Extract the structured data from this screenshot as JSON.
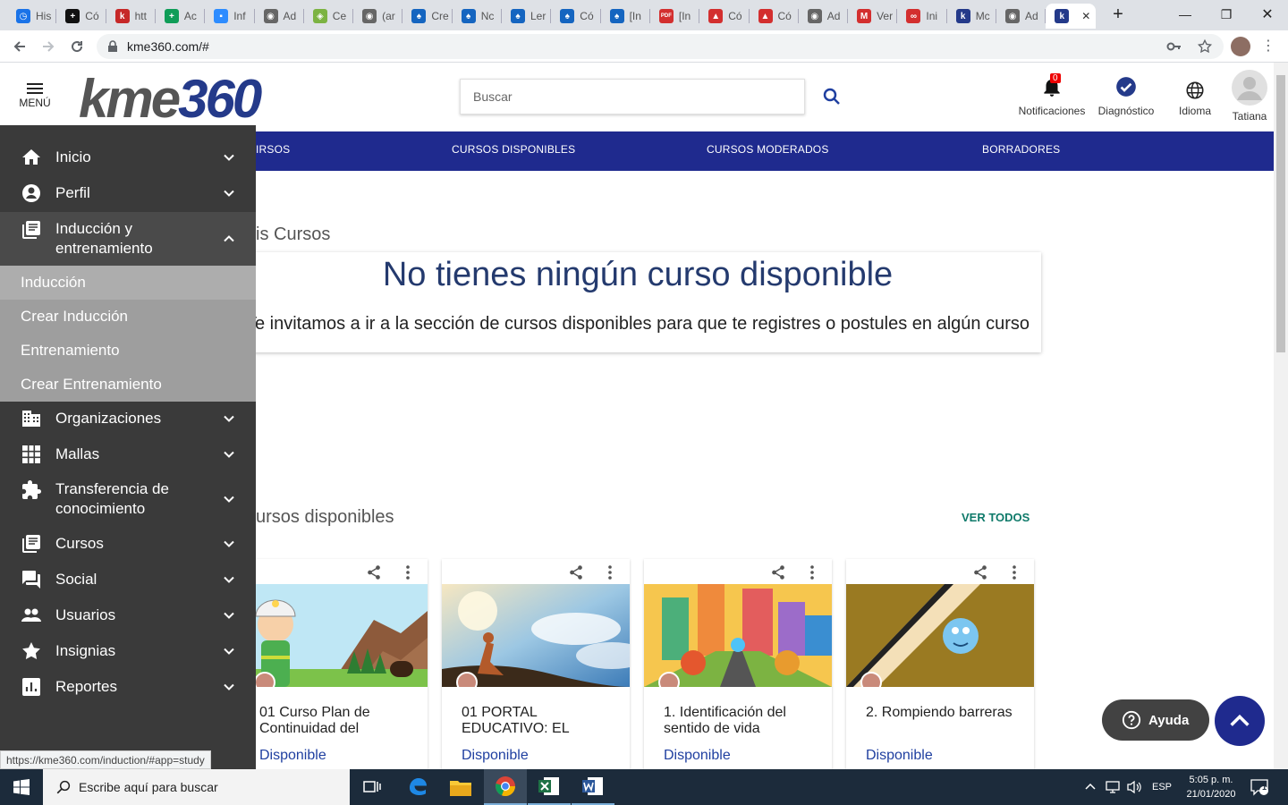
{
  "browser": {
    "tabs": [
      {
        "label": "His",
        "color": "#1a73e8",
        "glyph": "◷"
      },
      {
        "label": "Có",
        "color": "#111111",
        "glyph": "+"
      },
      {
        "label": "htt",
        "color": "#c62828",
        "glyph": "k"
      },
      {
        "label": "Ac",
        "color": "#0f9d58",
        "glyph": "+"
      },
      {
        "label": "Inf",
        "color": "#2d8cff",
        "glyph": "▪"
      },
      {
        "label": "Ad",
        "color": "#666666",
        "glyph": "◉"
      },
      {
        "label": "Ce",
        "color": "#7cb342",
        "glyph": "◈"
      },
      {
        "label": "(ar",
        "color": "#666666",
        "glyph": "◉"
      },
      {
        "label": "Cre",
        "color": "#1565c0",
        "glyph": "♠"
      },
      {
        "label": "Nc",
        "color": "#1565c0",
        "glyph": "♠"
      },
      {
        "label": "Ler",
        "color": "#1565c0",
        "glyph": "♠"
      },
      {
        "label": "Có",
        "color": "#1565c0",
        "glyph": "♠"
      },
      {
        "label": "[In",
        "color": "#1565c0",
        "glyph": "♠"
      },
      {
        "label": "[In",
        "color": "#d32f2f",
        "glyph": "PDF"
      },
      {
        "label": "Có",
        "color": "#d32f2f",
        "glyph": "▲"
      },
      {
        "label": "Có",
        "color": "#d32f2f",
        "glyph": "▲"
      },
      {
        "label": "Ad",
        "color": "#666666",
        "glyph": "◉"
      },
      {
        "label": "Ver",
        "color": "#d32f2f",
        "glyph": "M"
      },
      {
        "label": "Ini",
        "color": "#d32f2f",
        "glyph": "∞"
      },
      {
        "label": "Mc",
        "color": "#243a8a",
        "glyph": "k"
      },
      {
        "label": "Ad",
        "color": "#666666",
        "glyph": "◉"
      },
      {
        "label": "",
        "color": "#243a8a",
        "glyph": "k"
      }
    ],
    "url": "kme360.com/#",
    "status_url": "https://kme360.com/induction/#app=study"
  },
  "header": {
    "menu_label": "MENÚ",
    "logo_text": "kme",
    "logo_num": "360",
    "search_placeholder": "Buscar",
    "notifications_label": "Notificaciones",
    "notifications_count": "0",
    "diagnostic_label": "Diagnóstico",
    "language_label": "Idioma",
    "user_name": "Tatiana"
  },
  "blue_nav": {
    "items": [
      "IRSOS",
      "CURSOS DISPONIBLES",
      "CURSOS MODERADOS",
      "BORRADORES"
    ]
  },
  "main": {
    "my_courses_title": "is Cursos",
    "empty_title": "No tienes ningún curso disponible",
    "empty_text": "Te invitamos a ir a la sección de cursos disponibles para que te registres o postules en algún curso",
    "available_title": "ursos disponibles",
    "see_all": "VER TODOS",
    "cards": [
      {
        "title": "01 Curso Plan de Continuidad del",
        "status": "Disponible"
      },
      {
        "title": "01 PORTAL EDUCATIVO: EL",
        "status": "Disponible"
      },
      {
        "title": "1. Identificación del sentido de vida",
        "status": "Disponible"
      },
      {
        "title": "2. Rompiendo barreras",
        "status": "Disponible"
      }
    ]
  },
  "sidebar": {
    "items": [
      {
        "label": "Inicio"
      },
      {
        "label": "Perfil"
      },
      {
        "label": "Inducción y entrenamiento"
      },
      {
        "label": "Organizaciones"
      },
      {
        "label": "Mallas"
      },
      {
        "label": "Transferencia de conocimiento"
      },
      {
        "label": "Cursos"
      },
      {
        "label": "Social"
      },
      {
        "label": "Usuarios"
      },
      {
        "label": "Insignias"
      },
      {
        "label": "Reportes"
      }
    ],
    "subitems": [
      {
        "label": "Inducción"
      },
      {
        "label": "Crear Inducción"
      },
      {
        "label": "Entrenamiento"
      },
      {
        "label": "Crear Entrenamiento"
      }
    ]
  },
  "floating": {
    "help_label": "Ayuda"
  },
  "taskbar": {
    "search_placeholder": "Escribe aquí para buscar",
    "lang": "ESP",
    "time": "5:05 p. m.",
    "date": "21/01/2020",
    "notif_count": "1"
  },
  "colors": {
    "brand_blue": "#1f2a8e",
    "sidebar_bg": "#3a3a3a",
    "submenu_bg": "#9e9e9e",
    "title_blue": "#243a6e",
    "link_green": "#0f7a6a"
  }
}
